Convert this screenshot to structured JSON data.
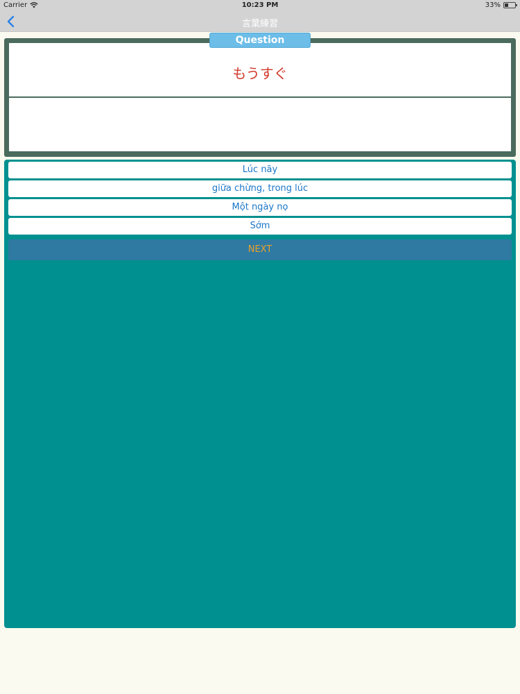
{
  "status_bar": {
    "carrier": "Carrier",
    "time": "10:23 PM",
    "battery": "33%",
    "battery_level": 0.33
  },
  "nav": {
    "title": "言葉練習",
    "back_icon": "chevron-left-icon"
  },
  "question": {
    "tab_label": "Question",
    "word": "もうすぐ",
    "answer": ""
  },
  "options": [
    {
      "label": "Lúc nãy"
    },
    {
      "label": "giữa chừng, trong lúc"
    },
    {
      "label": "Một ngày nọ"
    },
    {
      "label": "Sớm"
    }
  ],
  "next_label": "NEXT",
  "colors": {
    "nav_background": "#d3d3d3",
    "question_border": "#4a6b5d",
    "question_tab": "#6cbde8",
    "question_word": "#d23a2c",
    "answers_background": "#009090",
    "option_text": "#1b76c8",
    "next_background": "#2f7aa3",
    "next_text": "#e9a12a",
    "page_background": "#fbfaf0"
  }
}
